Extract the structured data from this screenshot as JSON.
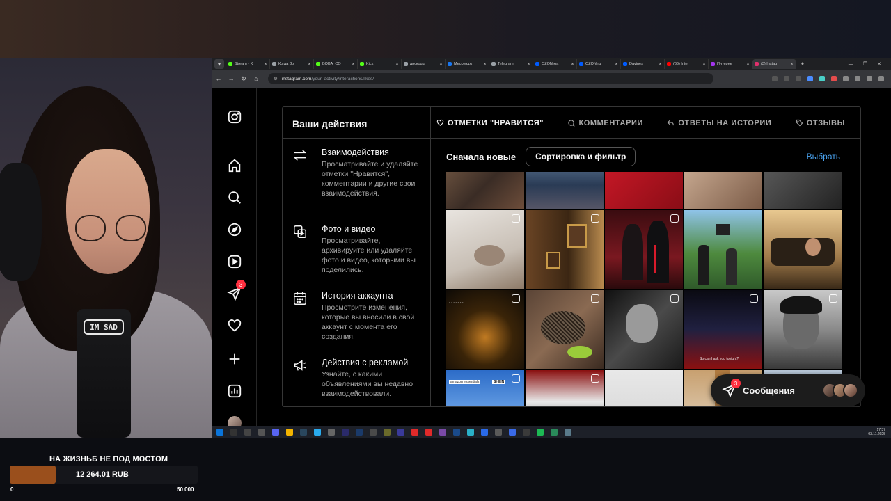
{
  "browser": {
    "tabs": [
      {
        "label": "Stream - K",
        "color": "#53fc18"
      },
      {
        "label": "Когда Зо",
        "color": "#9aa0a6"
      },
      {
        "label": "BOBA_CO",
        "color": "#53fc18"
      },
      {
        "label": "Kick",
        "color": "#53fc18"
      },
      {
        "label": "дискорд",
        "color": "#9aa0a6"
      },
      {
        "label": "Мессендж",
        "color": "#1877f2"
      },
      {
        "label": "Telegram",
        "color": "#9aa0a6"
      },
      {
        "label": "OZON ма",
        "color": "#005bff"
      },
      {
        "label": "OZON.ru",
        "color": "#005bff"
      },
      {
        "label": "Davines",
        "color": "#005bff"
      },
      {
        "label": "(66) Inter",
        "color": "#ff0000"
      },
      {
        "label": "Интерне",
        "color": "#a335ee"
      },
      {
        "label": "(3) Instag",
        "color": "#e1306c"
      }
    ],
    "url_host": "instagram.com",
    "url_path": "/your_activity/interactions/likes/"
  },
  "instagram": {
    "rail_notifications": "3",
    "side_title": "Ваши действия",
    "side_items": [
      {
        "title": "Взаимодействия",
        "desc": "Просматривайте и удаляйте отметки \"Нравится\", комментарии и другие свои взаимодействия.",
        "icon": "arrows-swap-icon"
      },
      {
        "title": "Фото и видео",
        "desc": "Просматривайте, архивируйте или удаляйте фото и видео, которыми вы поделились.",
        "icon": "photo-video-icon"
      },
      {
        "title": "История аккаунта",
        "desc": "Просмотрите изменения, которые вы вносили в свой аккаунт с момента его создания.",
        "icon": "calendar-icon"
      },
      {
        "title": "Действия с рекламой",
        "desc": "Узнайте, с какими объявлениями вы недавно взаимодействовали.",
        "icon": "megaphone-icon"
      }
    ],
    "tabs": [
      {
        "label": "ОТМЕТКИ \"НРАВИТСЯ\"",
        "icon": "heart-icon",
        "active": true
      },
      {
        "label": "КОММЕНТАРИИ",
        "icon": "comment-icon",
        "active": false
      },
      {
        "label": "ОТВЕТЫ НА ИСТОРИИ",
        "icon": "reply-icon",
        "active": false
      },
      {
        "label": "ОТЗЫВЫ",
        "icon": "tag-icon",
        "active": false
      }
    ],
    "sort_label": "Сначала новые",
    "sort_button": "Сортировка и фильтр",
    "select_link": "Выбрать",
    "grid_overlays": {
      "shein": "SHEIN",
      "amazon": "amazon essentials",
      "caption": "So can I ask you tonight?"
    },
    "messages": {
      "label": "Сообщения",
      "badge": "3"
    }
  },
  "taskbar": {
    "time": "17:37",
    "date": "03.11.2025"
  },
  "donation": {
    "title": "НА ЖИЗНЬБ НЕ ПОД МОСТОМ",
    "amount": "12 264.01 RUB",
    "min": "0",
    "max": "50 000",
    "progress": 0.245,
    "fill_color": "#9a4f1c"
  },
  "webcam": {
    "mic_label": "IM SAD"
  }
}
